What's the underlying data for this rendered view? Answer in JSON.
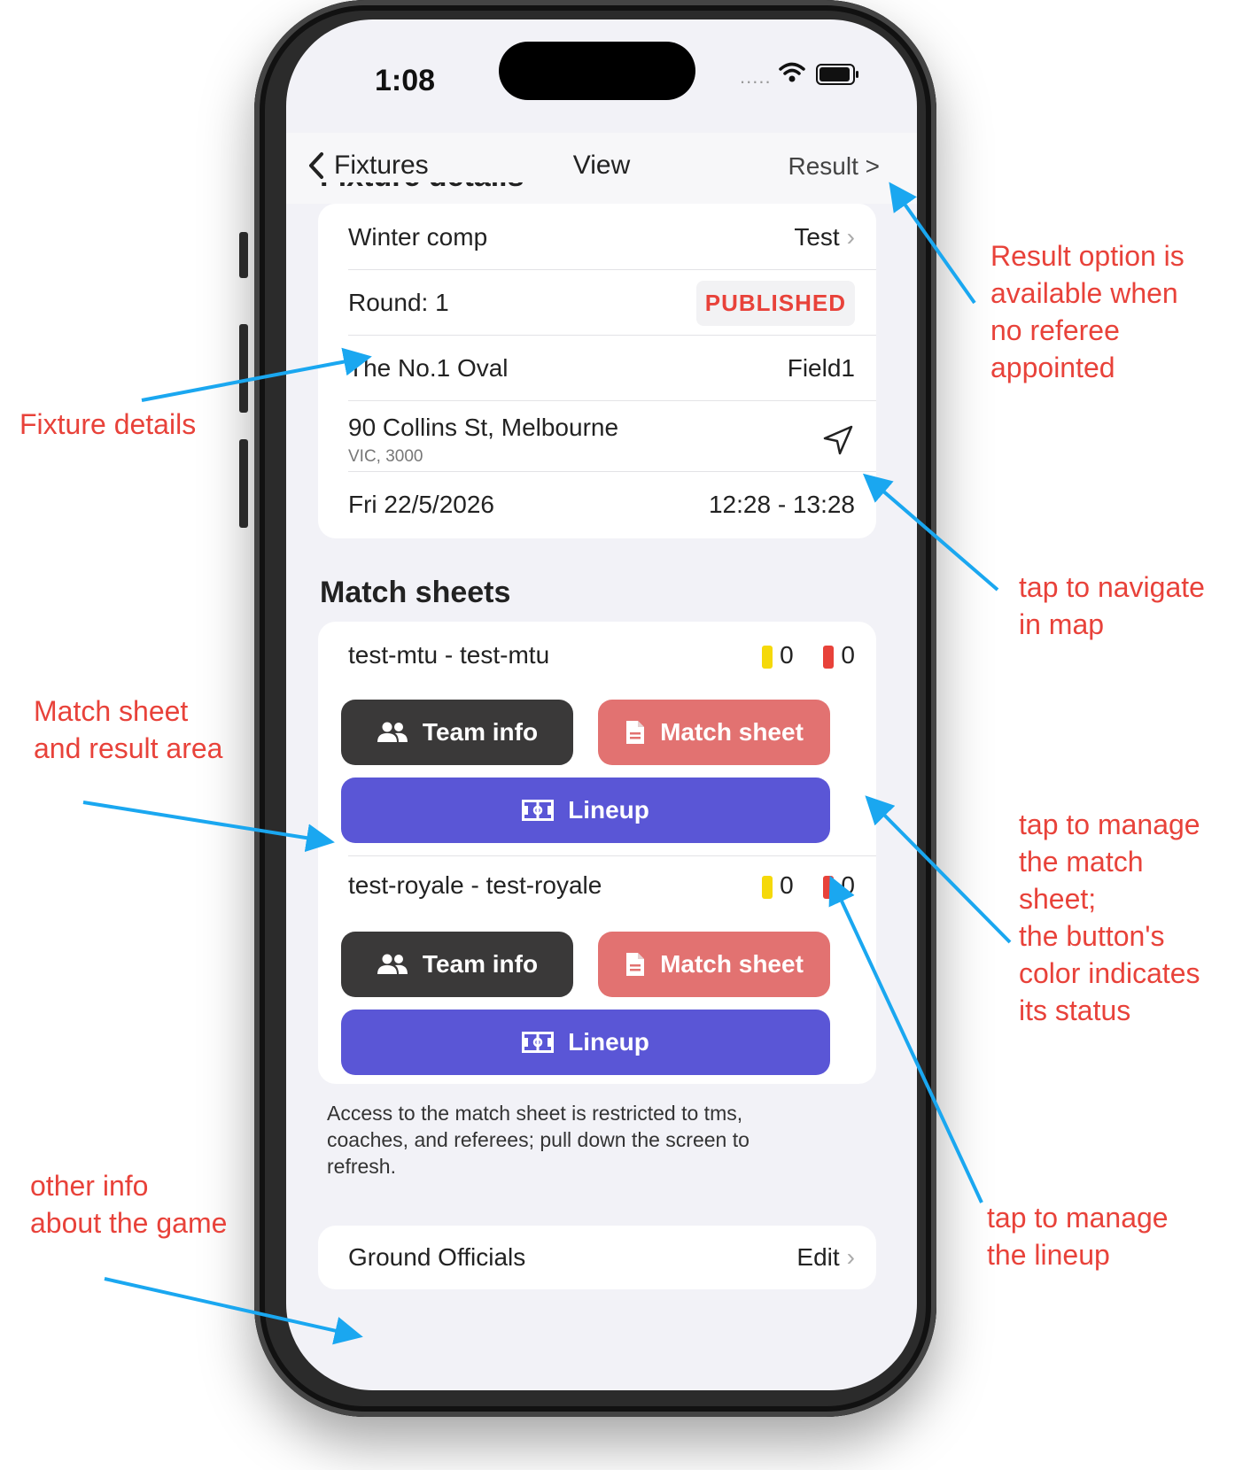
{
  "status_bar": {
    "time": "1:08",
    "dots": "....."
  },
  "nav": {
    "back_label": "Fixtures",
    "title": "View",
    "result_label": "Result >"
  },
  "fixture": {
    "section_title": "Fixture details",
    "competition": "Winter comp",
    "competition_value": "Test",
    "round": "Round: 1",
    "status": "PUBLISHED",
    "venue": "The No.1 Oval",
    "field": "Field1",
    "address_line1": "90 Collins St, Melbourne",
    "address_line2": "VIC, 3000",
    "date": "Fri 22/5/2026",
    "time": "12:28 - 13:28"
  },
  "match_sheets": {
    "section_title": "Match sheets",
    "teams": [
      {
        "name": "test-mtu - test-mtu",
        "yellow": "0",
        "red": "0",
        "team_info": "Team info",
        "match_sheet": "Match sheet",
        "lineup": "Lineup"
      },
      {
        "name": "test-royale - test-royale",
        "yellow": "0",
        "red": "0",
        "team_info": "Team info",
        "match_sheet": "Match sheet",
        "lineup": "Lineup"
      }
    ],
    "note": "Access to the match sheet is restricted to tms, coaches, and referees; pull down the screen to refresh."
  },
  "ground_officials": {
    "label": "Ground Officials",
    "action": "Edit"
  },
  "annotations": {
    "result": [
      "Result option is",
      "available when",
      "no referee",
      "appointed"
    ],
    "fixture": [
      "Fixture details"
    ],
    "navigate": [
      "tap to navigate",
      "in map"
    ],
    "match_area": [
      "Match sheet",
      "and result area"
    ],
    "manage_sheet": [
      "tap to manage",
      "the match",
      "sheet;",
      "the button's",
      "color indicates",
      "its status"
    ],
    "other_info": [
      "other info",
      "about the game"
    ],
    "lineup": [
      "tap to manage",
      "the lineup"
    ]
  },
  "colors": {
    "annotation": "#e8423a",
    "arrow": "#1aa7f0",
    "team_info_btn": "#3a3939",
    "match_sheet_btn": "#e27271",
    "lineup_btn": "#5a56d6",
    "yellow_card": "#f5d90a",
    "red_card": "#e8423a"
  },
  "icons": [
    "chevron-left-icon",
    "navigate-arrow-icon",
    "users-icon",
    "document-icon",
    "pitch-icon",
    "wifi-icon",
    "battery-icon"
  ]
}
